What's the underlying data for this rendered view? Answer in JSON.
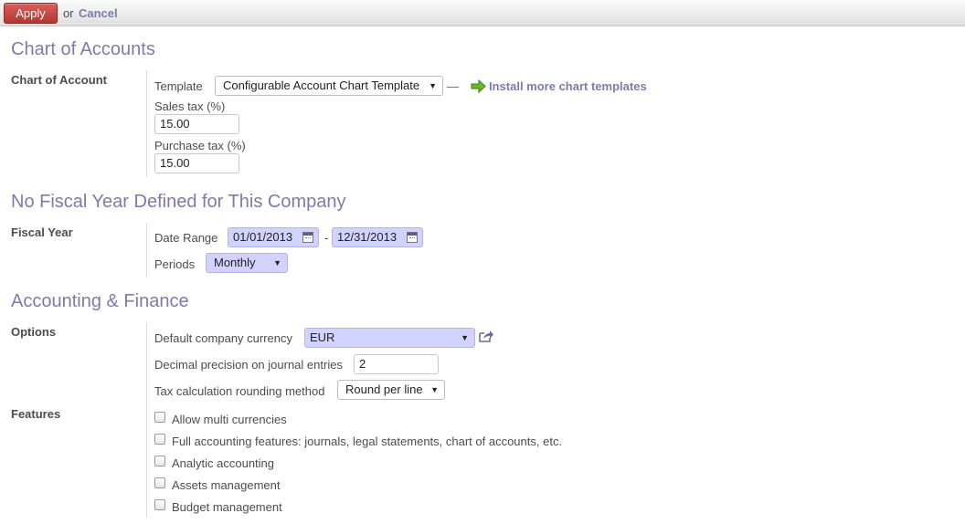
{
  "toolbar": {
    "apply_label": "Apply",
    "or_text": "or",
    "cancel_label": "Cancel"
  },
  "chart_section": {
    "title": "Chart of Accounts",
    "group_label": "Chart of Account",
    "template_label": "Template",
    "template_value": "Configurable Account Chart Template",
    "dash": "—",
    "install_link": "Install more chart templates",
    "sales_tax_label": "Sales tax (%)",
    "sales_tax_value": "15.00",
    "purchase_tax_label": "Purchase tax (%)",
    "purchase_tax_value": "15.00"
  },
  "fiscal_section": {
    "title": "No Fiscal Year Defined for This Company",
    "group_label": "Fiscal Year",
    "date_range_label": "Date Range",
    "date_from": "01/01/2013",
    "date_separator": "-",
    "date_to": "12/31/2013",
    "periods_label": "Periods",
    "periods_value": "Monthly"
  },
  "finance_section": {
    "title": "Accounting & Finance",
    "options_label": "Options",
    "currency_label": "Default company currency",
    "currency_value": "EUR",
    "decimal_label": "Decimal precision on journal entries",
    "decimal_value": "2",
    "rounding_label": "Tax calculation rounding method",
    "rounding_value": "Round per line",
    "features_label": "Features",
    "features": [
      {
        "label": "Allow multi currencies",
        "checked": false
      },
      {
        "label": "Full accounting features: journals, legal statements, chart of accounts, etc.",
        "checked": false
      },
      {
        "label": "Analytic accounting",
        "checked": false
      },
      {
        "label": "Assets management",
        "checked": false
      },
      {
        "label": "Budget management",
        "checked": false
      }
    ]
  },
  "colors": {
    "accent": "#7c7bad",
    "apply_button": "#c5403a",
    "required_field": "#d2d2ff"
  },
  "icons": {
    "install_icon": "green-arrow-icon",
    "currency_link_icon": "external-link-icon",
    "date_icon": "calendar-icon"
  }
}
